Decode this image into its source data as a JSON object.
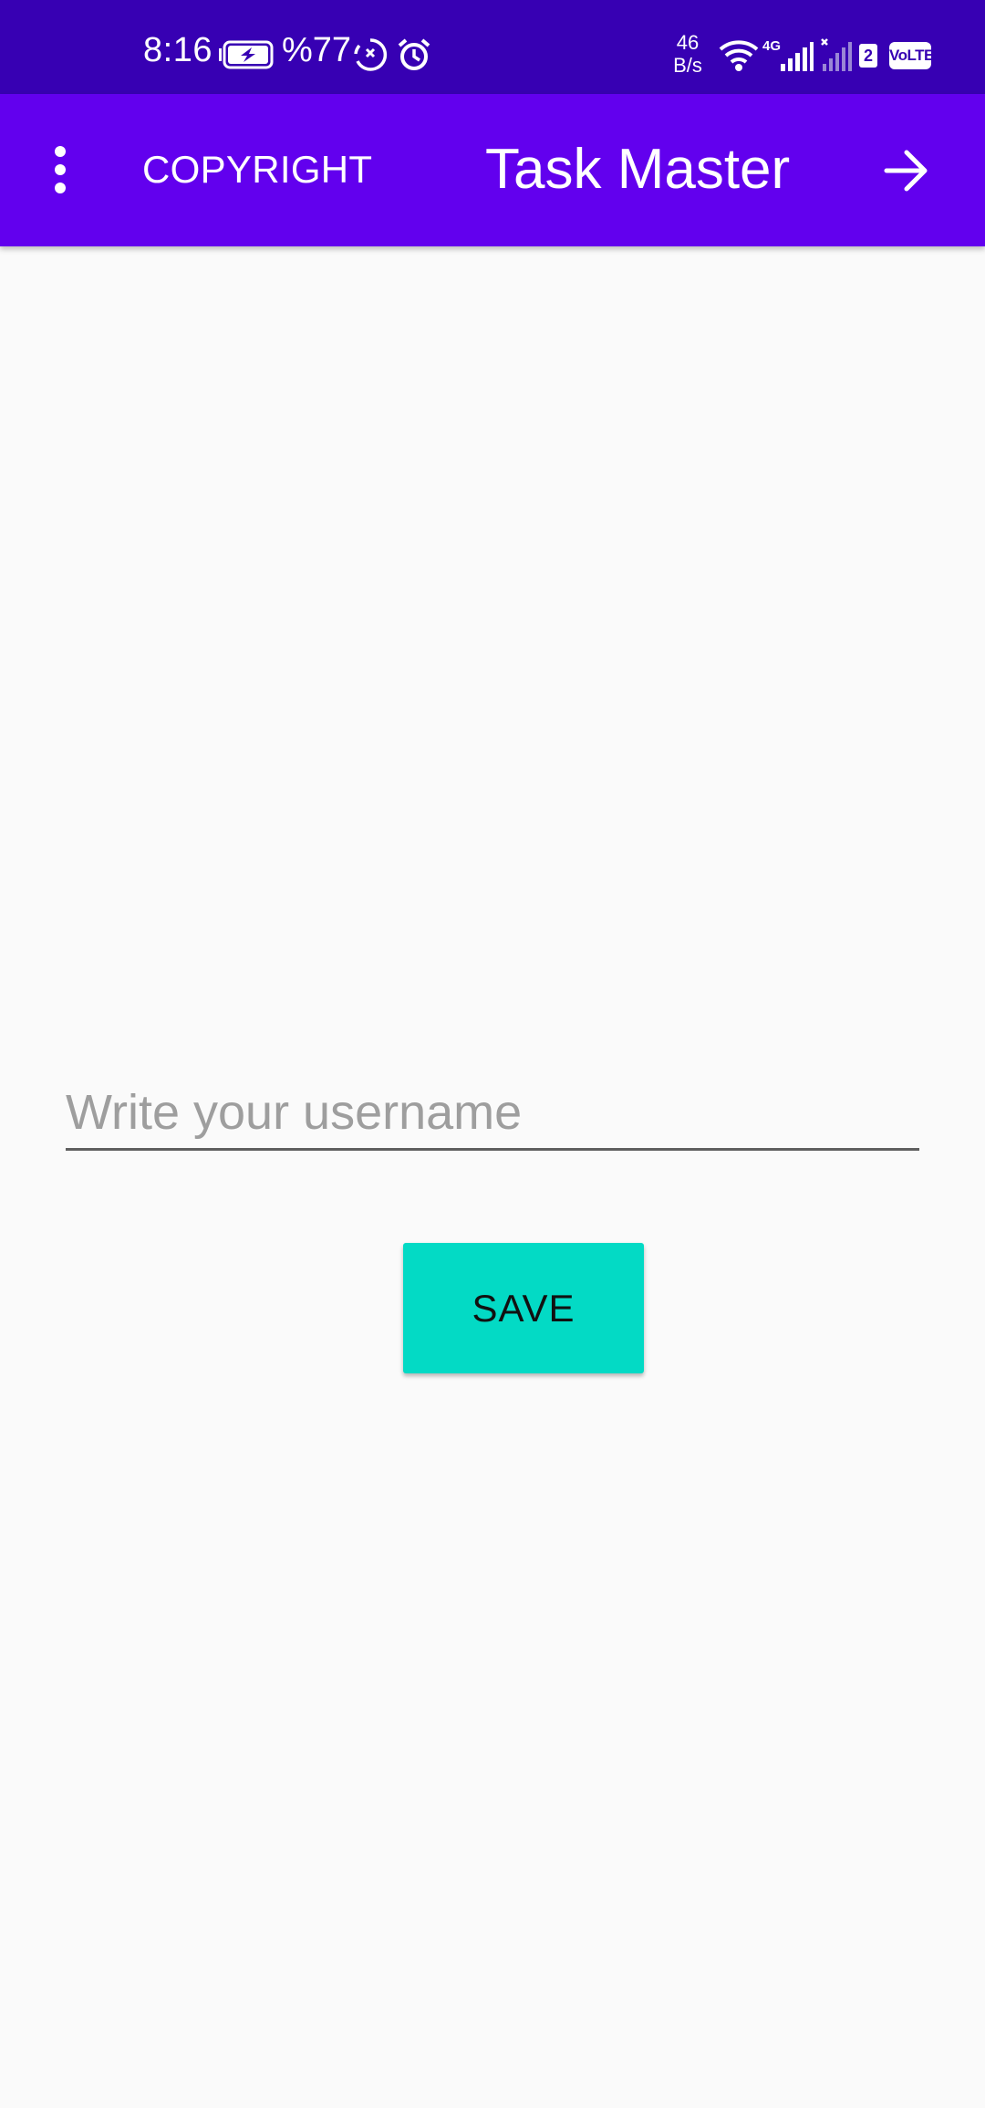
{
  "status_bar": {
    "time": "8:16",
    "battery_percent": "%77",
    "network_speed_value": "46",
    "network_speed_unit": "B/s",
    "network_type": "4G",
    "sim_slot": "2",
    "volte": "VoLTE"
  },
  "app_bar": {
    "overflow_icon": "more-vertical-icon",
    "copyright_label": "COPYRIGHT",
    "title": "Task Master",
    "next_icon": "arrow-right-icon"
  },
  "form": {
    "username_placeholder": "Write your username",
    "username_value": "",
    "save_label": "SAVE"
  },
  "colors": {
    "status_bar": "#3700b3",
    "app_bar": "#6200ee",
    "accent": "#03dac5",
    "background": "#fafafa"
  }
}
